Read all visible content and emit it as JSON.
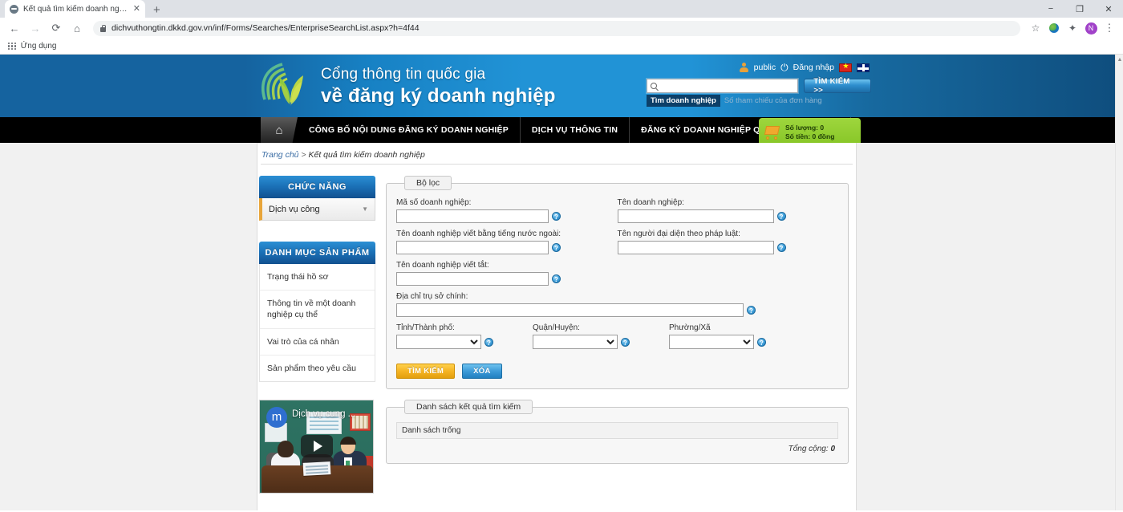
{
  "browser": {
    "tab_title": "Kết quả tìm kiếm doanh nghiệp",
    "tab_close": "✕",
    "new_tab": "+",
    "url": "dichvuthongtin.dkkd.gov.vn/inf/Forms/Searches/EnterpriseSearchList.aspx?h=4f44",
    "back": "←",
    "forward": "→",
    "reload": "⟳",
    "home": "⌂",
    "star": "☆",
    "puzzle": "✦",
    "profile_initial": "N",
    "kebab": "⋮",
    "minimize": "−",
    "maximize": "❐",
    "close": "✕",
    "bookmark_label": "Ứng dụng"
  },
  "header": {
    "brand_line1": "Cổng thông tin quốc gia",
    "brand_line2": "về đăng ký doanh nghiệp",
    "account_name": "public",
    "login_label": "Đăng nhập",
    "search_value": "",
    "search_placeholder": "",
    "search_button": "TÌM KIẾM >>",
    "search_tab_active": "Tìm doanh nghiệp",
    "search_tab_inactive": "Số tham chiếu của đơn hàng",
    "lang_vn": "VN",
    "lang_en": "EN"
  },
  "nav": {
    "home_icon": "⌂",
    "items": [
      {
        "label": "CÔNG BỐ NỘI DUNG ĐĂNG KÝ DOANH NGHIỆP"
      },
      {
        "label": "DỊCH VỤ THÔNG TIN"
      },
      {
        "label": "ĐĂNG KÝ DOANH NGHIỆP QUA MẠNG ĐIỆN TỬ"
      }
    ],
    "cart_qty": "Số lượng: 0",
    "cart_amount": "Số tiền: 0 đồng"
  },
  "breadcrumb": {
    "home": "Trang chủ",
    "separator": ">",
    "current": "Kết quả tìm kiếm doanh nghiệp"
  },
  "sidebar": {
    "functions_title": "CHỨC NĂNG",
    "functions_selected": "Dịch vụ công",
    "chevron": "▼",
    "catalog_title": "DANH MỤC SẢN PHẨM",
    "catalog_items": [
      {
        "label": "Trạng thái hồ sơ"
      },
      {
        "label": "Thông tin về một doanh nghiệp cụ thể"
      },
      {
        "label": "Vai trò của cá nhân"
      },
      {
        "label": "Sản phẩm theo yêu cầu"
      }
    ],
    "video_badge": "m",
    "video_title": "Dịch vụ cung ...",
    "video_play": "▶"
  },
  "filter": {
    "legend": "Bộ lọc",
    "fields": {
      "enterprise_code_label": "Mã số doanh nghiệp:",
      "enterprise_code_value": "",
      "enterprise_name_label": "Tên doanh nghiệp:",
      "enterprise_name_value": "",
      "foreign_name_label": "Tên doanh nghiệp viết bằng tiếng nước ngoài:",
      "foreign_name_value": "",
      "legal_rep_label": "Tên người đại diện theo pháp luật:",
      "legal_rep_value": "",
      "short_name_label": "Tên doanh nghiệp viết tắt:",
      "short_name_value": "",
      "address_label": "Địa chỉ trụ sở chính:",
      "address_value": "",
      "province_label": "Tỉnh/Thành phố:",
      "province_value": "",
      "district_label": "Quận/Huyện:",
      "district_value": "",
      "ward_label": "Phường/Xã",
      "ward_value": ""
    },
    "help_icon": "?",
    "search_button": "TÌM KIẾM",
    "clear_button": "XÓA"
  },
  "results": {
    "legend": "Danh sách kết quả tìm kiếm",
    "empty_text": "Danh sách trống",
    "total_label": "Tổng cộng:",
    "total_value": "0"
  },
  "colors": {
    "header_blue": "#2193d6",
    "header_blue_dark": "#15639f",
    "nav_black": "#000000",
    "panel_blue": "#1a6fb5",
    "accent_orange": "#e8a53a",
    "cart_green": "#9ed63d",
    "button_yellow": "#f5b423",
    "button_blue": "#3d9bd8"
  }
}
